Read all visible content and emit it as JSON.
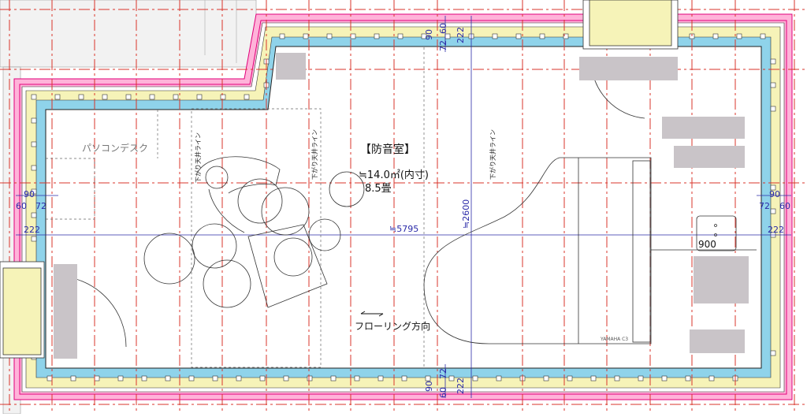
{
  "room": {
    "title": "【防音室】",
    "area": "≒14.0㎡(内寸)",
    "tatami": "8.5畳",
    "width_dim": "≒5795",
    "height_dim": "≒2600",
    "flooring": "フローリング方向",
    "desk": "パソコンデスク",
    "ceiling_label": "下がり天井ライン",
    "piano_brand": "YAMAHA C3",
    "bench_dim": "900"
  },
  "wall_layers": {
    "top": [
      "90",
      "60",
      "222",
      "72"
    ],
    "left": [
      "90",
      "60",
      "72",
      "222"
    ],
    "right": [
      "90",
      "72",
      "60",
      "222"
    ],
    "bottom": [
      "72",
      "90",
      "222",
      "60"
    ]
  },
  "colors": {
    "pink": "#ffb3d9",
    "magenta": "#e0007a",
    "yellow": "#f6f3b8",
    "cyan": "#8fd3ea",
    "dim_blue": "#2a2aa8",
    "grid_red": "#d9342b"
  }
}
